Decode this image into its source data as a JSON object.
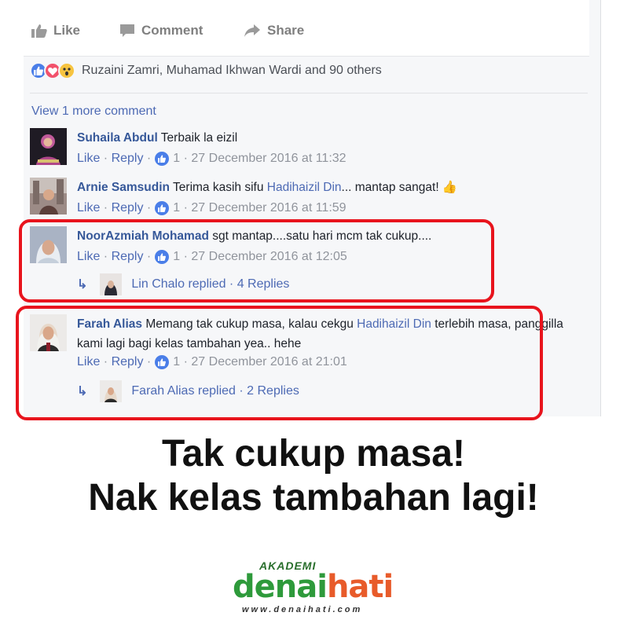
{
  "actions": {
    "like": "Like",
    "comment": "Comment",
    "share": "Share"
  },
  "reactions": {
    "text": "Ruzaini Zamri, Muhamad Ikhwan Wardi and 90 others"
  },
  "view_more": "View 1 more comment",
  "comments": [
    {
      "name": "Suhaila Abdul",
      "text": "Terbaik la eizil",
      "like": "Like",
      "reply": "Reply",
      "like_count": "1",
      "timestamp": "27 December 2016 at 11:32"
    },
    {
      "name": "Arnie Samsudin",
      "text_before": "Terima kasih sifu",
      "mention": "Hadihaizil Din",
      "text_after": "... mantap sangat! 👍",
      "like": "Like",
      "reply": "Reply",
      "like_count": "1",
      "timestamp": "27 December 2016 at 11:59"
    },
    {
      "name": "NoorAzmiah Mohamad",
      "text": "sgt mantap....satu hari mcm tak cukup....",
      "like": "Like",
      "reply": "Reply",
      "like_count": "1",
      "timestamp": "27 December 2016 at 12:05",
      "reply_summary": "Lin Chalo replied · 4 Replies"
    },
    {
      "name": "Farah Alias",
      "text_before": "Memang tak cukup masa, kalau cekgu",
      "mention": "Hadihaizil Din",
      "text_after": "terlebih masa, panggilla kami lagi bagi kelas tambahan yea.. hehe",
      "like": "Like",
      "reply": "Reply",
      "like_count": "1",
      "timestamp": "27 December 2016 at 21:01",
      "reply_summary": "Farah Alias replied · 2 Replies"
    }
  ],
  "headline": {
    "line1": "Tak cukup masa!",
    "line2": "Nak kelas tambahan lagi!"
  },
  "logo": {
    "top": "AKADEMI",
    "part1": "denai",
    "part2": "hati",
    "url": "www.denaihati.com"
  },
  "colors": {
    "fb_blue": "#365899",
    "link_blue": "#4d6ab4",
    "highlight_red": "#e8141d",
    "meta_gray": "#90949c"
  }
}
